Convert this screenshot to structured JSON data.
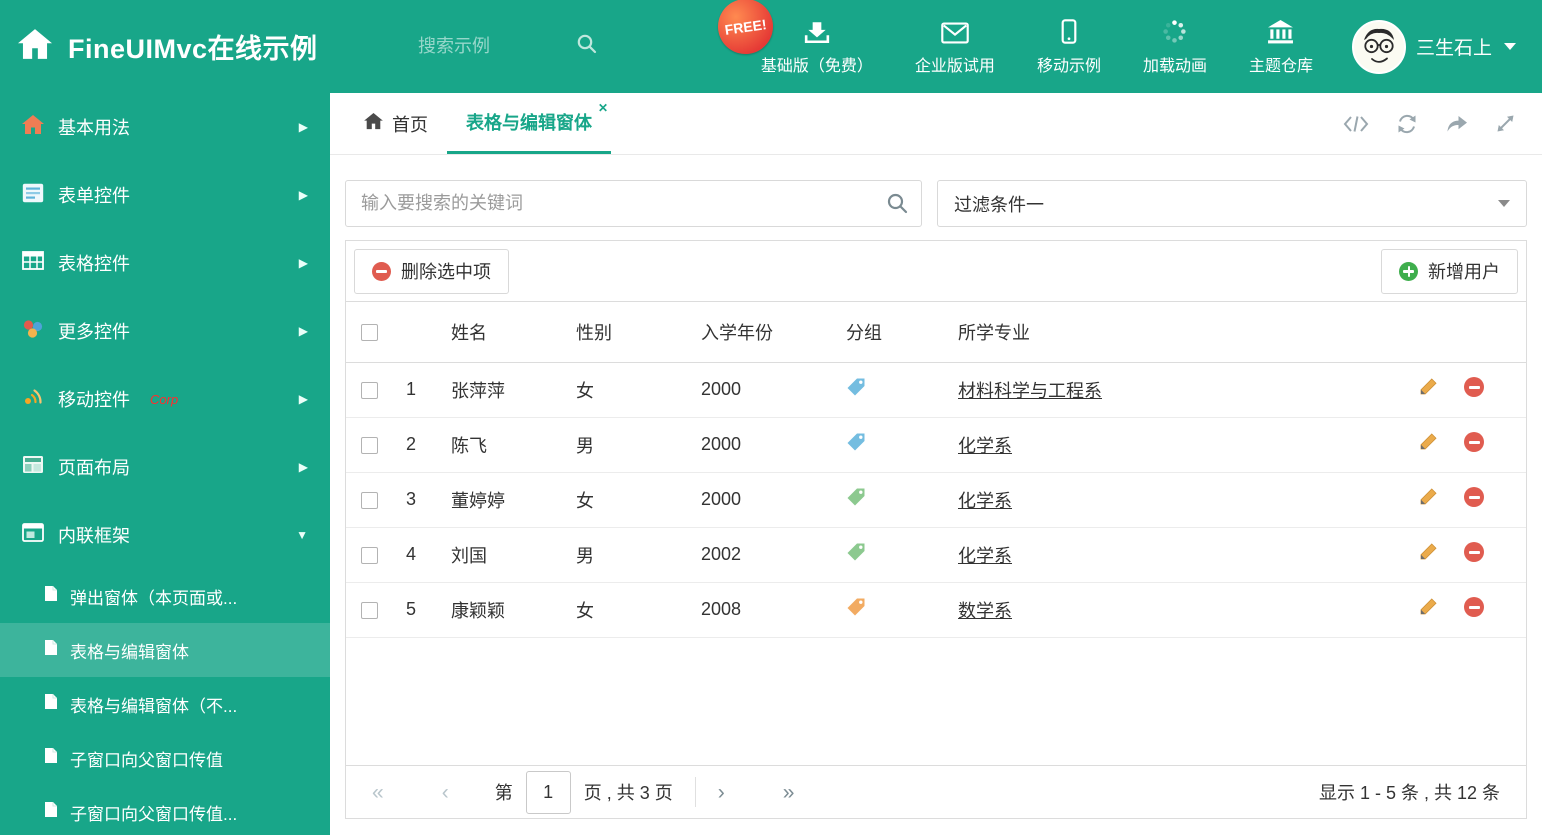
{
  "header": {
    "title": "FineUIMvc在线示例",
    "search_placeholder": "搜索示例",
    "free_badge": "FREE!",
    "nav": [
      {
        "label": "基础版（免费）",
        "icon": "download-icon"
      },
      {
        "label": "企业版试用",
        "icon": "envelope-icon"
      },
      {
        "label": "移动示例",
        "icon": "mobile-icon"
      },
      {
        "label": "加载动画",
        "icon": "spinner-icon"
      },
      {
        "label": "主题仓库",
        "icon": "bank-icon"
      }
    ],
    "user_name": "三生石上"
  },
  "sidebar": {
    "items": [
      {
        "label": "基本用法"
      },
      {
        "label": "表单控件"
      },
      {
        "label": "表格控件"
      },
      {
        "label": "更多控件"
      },
      {
        "label": "移动控件",
        "badge": "Corp"
      },
      {
        "label": "页面布局"
      },
      {
        "label": "内联框架"
      }
    ],
    "subitems": [
      {
        "label": "弹出窗体（本页面或..."
      },
      {
        "label": "表格与编辑窗体"
      },
      {
        "label": "表格与编辑窗体（不..."
      },
      {
        "label": "子窗口向父窗口传值"
      },
      {
        "label": "子窗口向父窗口传值..."
      }
    ]
  },
  "tabs": {
    "home": "首页",
    "active": "表格与编辑窗体"
  },
  "filters": {
    "search_placeholder": "输入要搜索的关键词",
    "filter_selected": "过滤条件一"
  },
  "toolbar": {
    "delete_label": "删除选中项",
    "add_label": "新增用户"
  },
  "table": {
    "columns": [
      "姓名",
      "性别",
      "入学年份",
      "分组",
      "所学专业"
    ],
    "rows": [
      {
        "num": "1",
        "name": "张萍萍",
        "gender": "女",
        "year": "2000",
        "tag_color": "#74bde0",
        "major": "材料科学与工程系"
      },
      {
        "num": "2",
        "name": "陈飞",
        "gender": "男",
        "year": "2000",
        "tag_color": "#74bde0",
        "major": "化学系"
      },
      {
        "num": "3",
        "name": "董婷婷",
        "gender": "女",
        "year": "2000",
        "tag_color": "#8cc98f",
        "major": "化学系"
      },
      {
        "num": "4",
        "name": "刘国",
        "gender": "男",
        "year": "2002",
        "tag_color": "#8cc98f",
        "major": "化学系"
      },
      {
        "num": "5",
        "name": "康颖颖",
        "gender": "女",
        "year": "2008",
        "tag_color": "#f2ab62",
        "major": "数学系"
      }
    ]
  },
  "pagination": {
    "label_page": "第",
    "current": "1",
    "label_total": "页 , 共 3 页",
    "summary": "显示 1 - 5 条 , 共 12 条"
  },
  "colors": {
    "accent": "#18a689",
    "danger": "#e05c50",
    "success": "#3fae4d"
  }
}
